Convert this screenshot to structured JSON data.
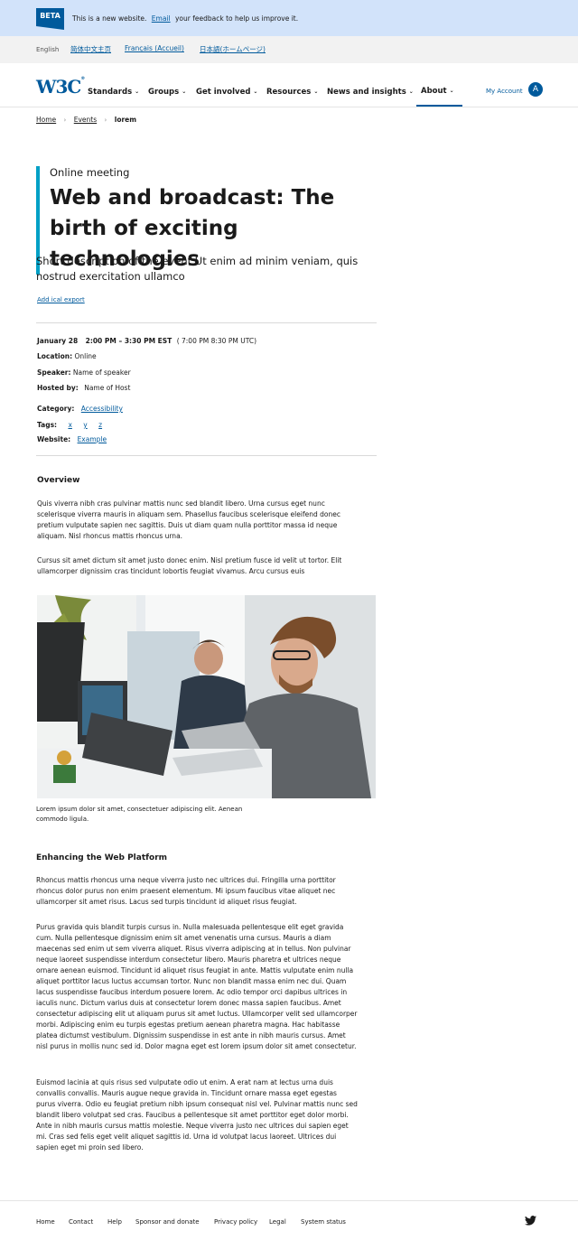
{
  "beta_banner": {
    "badge": "BETA",
    "text_before": "This is a new website.",
    "link": "Email",
    "text_after": "your feedback to help us improve it."
  },
  "languages": {
    "current": "English",
    "links": [
      "简体中文主页",
      "Français (Accueil)",
      "日本語(ホームページ)"
    ]
  },
  "nav": {
    "logo": "W3C",
    "items": [
      "Standards",
      "Groups",
      "Get involved",
      "Resources",
      "News and insights",
      "About"
    ],
    "account_label": "My Account",
    "avatar_initial": "A"
  },
  "breadcrumb": {
    "home": "Home",
    "events": "Events",
    "current": "lorem"
  },
  "event": {
    "kicker": "Online meeting",
    "title": "Web and broadcast: The birth of exciting technologies",
    "short_description": "Short description of the event Ut enim ad minim veniam, quis nostrud exercitation ullamco",
    "ical_link": "Add ical export",
    "date": "January 28",
    "time": "2:00 PM  – 3:30 PM EST",
    "time_utc": "( 7:00 PM 8:30 PM UTC)",
    "location_label": "Location:",
    "location": "Online",
    "speaker_label": "Speaker:",
    "speaker": "Name of speaker",
    "host_label": "Hosted by:",
    "host": "Name of Host",
    "category_label": "Category:",
    "category": "Accessibility",
    "tags_label": "Tags:",
    "tags": [
      "x",
      "y",
      "z"
    ],
    "website_label": "Website:",
    "website": "Example"
  },
  "overview": {
    "heading": "Overview",
    "p1": "Quis viverra nibh cras pulvinar mattis nunc sed blandit libero. Urna cursus eget nunc scelerisque viverra mauris in aliquam sem. Phasellus faucibus scelerisque eleifend donec pretium vulputate sapien nec sagittis. Duis ut diam quam nulla porttitor massa id neque aliquam. Nisl rhoncus mattis rhoncus urna.",
    "p2": "Cursus sit amet dictum sit amet justo donec enim. Nisl pretium fusce id velit ut tortor. Elit ullamcorper dignissim cras tincidunt lobortis feugiat vivamus. Arcu cursus euis",
    "caption": "Lorem ipsum dolor sit amet, consectetuer adipiscing elit. Aenean commodo ligula."
  },
  "platform": {
    "heading": "Enhancing the Web Platform",
    "p1": "Rhoncus mattis rhoncus urna neque viverra justo nec ultrices dui. Fringilla urna porttitor rhoncus dolor purus non enim praesent elementum. Mi ipsum faucibus vitae aliquet nec ullamcorper sit amet risus. Lacus sed turpis tincidunt id aliquet risus feugiat.",
    "p2": "Purus gravida quis blandit turpis cursus in. Nulla malesuada pellentesque elit eget gravida cum. Nulla pellentesque dignissim enim sit amet venenatis urna cursus. Mauris a diam maecenas sed enim ut sem viverra aliquet. Risus viverra adipiscing at in tellus. Non pulvinar neque laoreet suspendisse interdum consectetur libero. Mauris pharetra et ultrices neque ornare aenean euismod. Tincidunt id aliquet risus feugiat in ante. Mattis vulputate enim nulla aliquet porttitor lacus luctus accumsan tortor. Nunc non blandit massa enim nec dui. Quam lacus suspendisse faucibus interdum posuere lorem. Ac odio tempor orci dapibus ultrices in iaculis nunc. Dictum varius duis at consectetur lorem donec massa sapien faucibus. Amet consectetur adipiscing elit ut aliquam purus sit amet luctus. Ullamcorper velit sed ullamcorper morbi. Adipiscing enim eu turpis egestas pretium aenean pharetra magna. Hac habitasse platea dictumst vestibulum. Dignissim suspendisse in est ante in nibh mauris cursus. Amet nisl purus in mollis nunc sed id. Dolor magna eget est lorem ipsum dolor sit amet consectetur.",
    "p3": "Euismod lacinia at quis risus sed vulputate odio ut enim. A erat nam at lectus urna duis convallis convallis. Mauris augue neque gravida in. Tincidunt ornare massa eget egestas purus viverra. Odio eu feugiat pretium nibh ipsum consequat nisl vel. Pulvinar mattis nunc sed blandit libero volutpat sed cras. Faucibus a pellentesque sit amet porttitor eget dolor morbi. Ante in nibh mauris cursus mattis molestie. Neque viverra justo nec ultrices dui sapien eget mi. Cras sed felis eget velit aliquet sagittis id. Urna id volutpat lacus laoreet. Ultrices dui sapien eget mi proin sed libero."
  },
  "footer": {
    "links": [
      "Home",
      "Contact",
      "Help",
      "Sponsor and donate",
      "Privacy policy",
      "Legal",
      "System status"
    ]
  },
  "colors": {
    "brand": "#005a9c",
    "accent_border": "#00a0c6",
    "beta_bg": "#d2e3fa"
  }
}
